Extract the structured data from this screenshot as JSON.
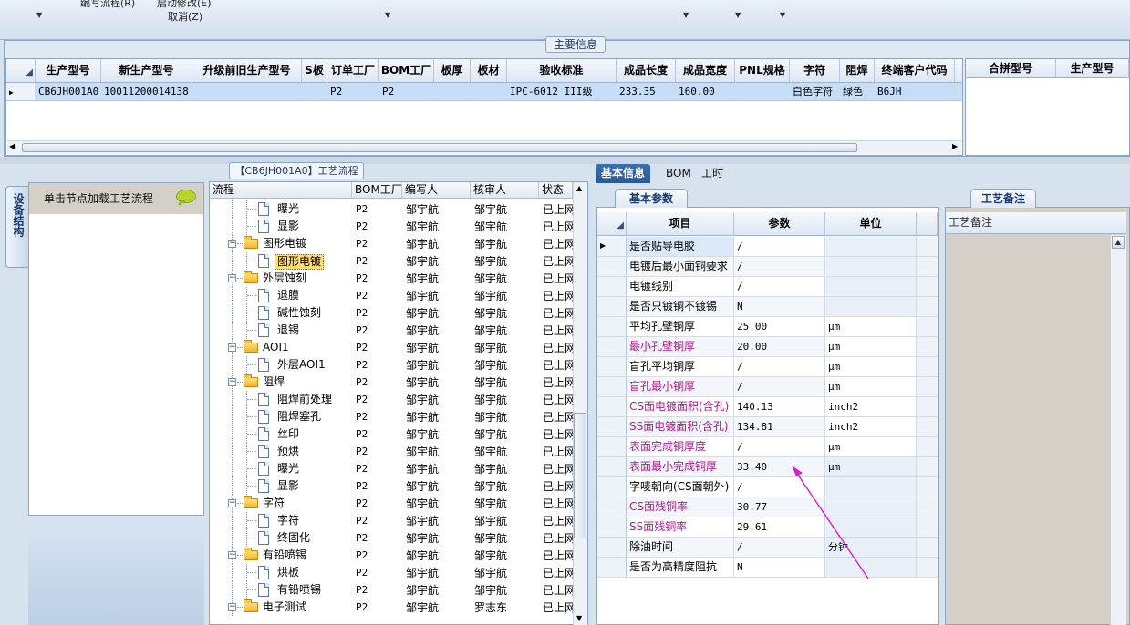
{
  "toolbar": {
    "items": [
      "编写流程(R)",
      "启动修改(E)",
      "取消(Z)"
    ]
  },
  "main_info": {
    "title": "主要信息",
    "columns": [
      "生产型号",
      "新生产型号",
      "升级前旧生产型号",
      "S板",
      "订单工厂",
      "BOM工厂",
      "板厚",
      "板材",
      "验收标准",
      "成品长度",
      "成品宽度",
      "PNL规格",
      "字符",
      "阻焊",
      "终端客户代码"
    ],
    "row": [
      "CB6JH001A0",
      "10011200014138",
      "",
      "",
      "P2",
      "P2",
      "",
      "",
      "IPC-6012 III级",
      "233.35",
      "160.00",
      "",
      "白色字符",
      "绿色",
      "B6JH"
    ],
    "combine_columns": [
      "合拼型号",
      "生产型号"
    ]
  },
  "device": {
    "tab_label": "设备结构",
    "hint": "单击节点加载工艺流程"
  },
  "flow": {
    "title": "【CB6JH001A0】工艺流程",
    "columns": [
      "流程",
      "BOM工厂",
      "编写人",
      "核审人",
      "状态"
    ],
    "rows": [
      {
        "name": "曝光",
        "level": 2,
        "bom": "P2",
        "writer": "邹宇航",
        "reviewer": "邹宇航",
        "status": "已上网"
      },
      {
        "name": "显影",
        "level": 2,
        "bom": "P2",
        "writer": "邹宇航",
        "reviewer": "邹宇航",
        "status": "已上网"
      },
      {
        "name": "图形电镀",
        "level": 1,
        "bom": "P2",
        "writer": "邹宇航",
        "reviewer": "邹宇航",
        "status": "已上网"
      },
      {
        "name": "图形电镀",
        "level": 2,
        "bom": "P2",
        "writer": "邹宇航",
        "reviewer": "邹宇航",
        "status": "已上网",
        "selected": true
      },
      {
        "name": "外层蚀刻",
        "level": 1,
        "bom": "P2",
        "writer": "邹宇航",
        "reviewer": "邹宇航",
        "status": "已上网"
      },
      {
        "name": "退膜",
        "level": 2,
        "bom": "P2",
        "writer": "邹宇航",
        "reviewer": "邹宇航",
        "status": "已上网"
      },
      {
        "name": "碱性蚀刻",
        "level": 2,
        "bom": "P2",
        "writer": "邹宇航",
        "reviewer": "邹宇航",
        "status": "已上网"
      },
      {
        "name": "退锡",
        "level": 2,
        "bom": "P2",
        "writer": "邹宇航",
        "reviewer": "邹宇航",
        "status": "已上网"
      },
      {
        "name": "AOI1",
        "level": 1,
        "bom": "P2",
        "writer": "邹宇航",
        "reviewer": "邹宇航",
        "status": "已上网"
      },
      {
        "name": "外层AOI1",
        "level": 2,
        "bom": "P2",
        "writer": "邹宇航",
        "reviewer": "邹宇航",
        "status": "已上网"
      },
      {
        "name": "阻焊",
        "level": 1,
        "bom": "P2",
        "writer": "邹宇航",
        "reviewer": "邹宇航",
        "status": "已上网"
      },
      {
        "name": "阻焊前处理",
        "level": 2,
        "bom": "P2",
        "writer": "邹宇航",
        "reviewer": "邹宇航",
        "status": "已上网"
      },
      {
        "name": "阻焊塞孔",
        "level": 2,
        "bom": "P2",
        "writer": "邹宇航",
        "reviewer": "邹宇航",
        "status": "已上网"
      },
      {
        "name": "丝印",
        "level": 2,
        "bom": "P2",
        "writer": "邹宇航",
        "reviewer": "邹宇航",
        "status": "已上网"
      },
      {
        "name": "预烘",
        "level": 2,
        "bom": "P2",
        "writer": "邹宇航",
        "reviewer": "邹宇航",
        "status": "已上网"
      },
      {
        "name": "曝光",
        "level": 2,
        "bom": "P2",
        "writer": "邹宇航",
        "reviewer": "邹宇航",
        "status": "已上网"
      },
      {
        "name": "显影",
        "level": 2,
        "bom": "P2",
        "writer": "邹宇航",
        "reviewer": "邹宇航",
        "status": "已上网"
      },
      {
        "name": "字符",
        "level": 1,
        "bom": "P2",
        "writer": "邹宇航",
        "reviewer": "邹宇航",
        "status": "已上网"
      },
      {
        "name": "字符",
        "level": 2,
        "bom": "P2",
        "writer": "邹宇航",
        "reviewer": "邹宇航",
        "status": "已上网"
      },
      {
        "name": "终固化",
        "level": 2,
        "bom": "P2",
        "writer": "邹宇航",
        "reviewer": "邹宇航",
        "status": "已上网"
      },
      {
        "name": "有铅喷锡",
        "level": 1,
        "bom": "P2",
        "writer": "邹宇航",
        "reviewer": "邹宇航",
        "status": "已上网"
      },
      {
        "name": "烘板",
        "level": 2,
        "bom": "P2",
        "writer": "邹宇航",
        "reviewer": "邹宇航",
        "status": "已上网"
      },
      {
        "name": "有铅喷锡",
        "level": 2,
        "bom": "P2",
        "writer": "邹宇航",
        "reviewer": "邹宇航",
        "status": "已上网"
      },
      {
        "name": "电子测试",
        "level": 1,
        "bom": "P2",
        "writer": "邹宇航",
        "reviewer": "罗志东",
        "status": "已上网"
      }
    ]
  },
  "tabs": [
    "基本信息",
    "BOM",
    "工时"
  ],
  "params": {
    "title": "基本参数",
    "columns": [
      "项目",
      "参数",
      "单位"
    ],
    "rows": [
      {
        "item": "是否贴导电胶",
        "value": "/",
        "unit": ""
      },
      {
        "item": "电镀后最小面铜要求",
        "value": "/",
        "unit": ""
      },
      {
        "item": "电镀线别",
        "value": "/",
        "unit": ""
      },
      {
        "item": "是否只镀铜不镀锡",
        "value": "N",
        "unit": ""
      },
      {
        "item": "平均孔壁铜厚",
        "value": "25.00",
        "unit": "μm"
      },
      {
        "item": "最小孔壁铜厚",
        "value": "20.00",
        "unit": "μm",
        "magenta": true
      },
      {
        "item": "盲孔平均铜厚",
        "value": "/",
        "unit": "μm"
      },
      {
        "item": "盲孔最小铜厚",
        "value": "/",
        "unit": "μm",
        "magenta": true
      },
      {
        "item": "CS面电镀面积(含孔)",
        "value": "140.13",
        "unit": "inch2",
        "magenta": true
      },
      {
        "item": "SS面电镀面积(含孔)",
        "value": "134.81",
        "unit": "inch2",
        "magenta": true
      },
      {
        "item": "表面完成铜厚度",
        "value": "/",
        "unit": "μm",
        "magenta": true
      },
      {
        "item": "表面最小完成铜厚",
        "value": "33.40",
        "unit": "μm",
        "magenta": true
      },
      {
        "item": "字唛朝向(CS面朝外)",
        "value": "/",
        "unit": ""
      },
      {
        "item": "CS面残铜率",
        "value": "30.77",
        "unit": "",
        "magenta": true
      },
      {
        "item": "SS面残铜率",
        "value": "29.61",
        "unit": "",
        "magenta": true
      },
      {
        "item": "除油时间",
        "value": "/",
        "unit": "分钟"
      },
      {
        "item": "是否为高精度阻抗",
        "value": "N",
        "unit": ""
      }
    ]
  },
  "remark": {
    "title": "工艺备注",
    "column": "工艺备注"
  },
  "colors": {
    "accent": "#2a5a99",
    "selection": "#c5ddf7",
    "tree_selection": "#ffdc7a",
    "magenta_label": "#b0188c",
    "annotation_arrow": "#d81fd0"
  }
}
